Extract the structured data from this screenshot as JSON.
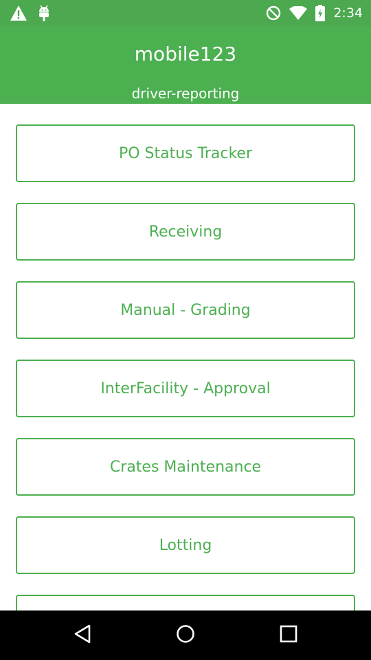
{
  "status_bar": {
    "time": "2:34",
    "icons": [
      "warning-icon",
      "android-debug-icon",
      "do-not-disturb-icon",
      "wifi-icon",
      "battery-icon"
    ]
  },
  "header": {
    "title": "mobile123",
    "subtitle": "driver-reporting"
  },
  "menu": {
    "items": [
      {
        "label": "PO Status Tracker"
      },
      {
        "label": "Receiving"
      },
      {
        "label": "Manual - Grading"
      },
      {
        "label": "InterFacility - Approval"
      },
      {
        "label": "Crates Maintenance"
      },
      {
        "label": "Lotting"
      },
      {
        "label": ""
      }
    ]
  },
  "nav_bar": {
    "buttons": [
      "back-icon",
      "home-icon",
      "recents-icon"
    ]
  },
  "colors": {
    "status_bar": "#4ca94f",
    "header": "#4caf50",
    "accent": "#4caf50",
    "nav_bar": "#000000"
  }
}
